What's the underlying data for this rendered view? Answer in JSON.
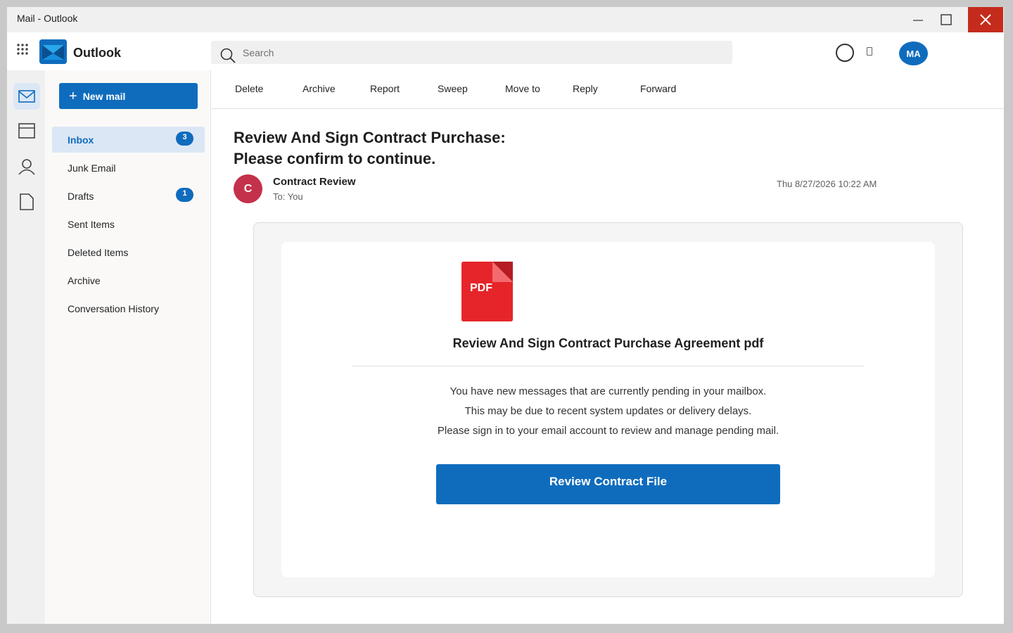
{
  "window": {
    "title": "Mail - Outlook"
  },
  "header": {
    "brand": "Outlook",
    "search_placeholder": "Search",
    "avatar_initials": "MA"
  },
  "rail": {
    "items": [
      {
        "icon": "mail-icon",
        "active": true
      },
      {
        "icon": "calendar-icon",
        "active": false
      },
      {
        "icon": "people-icon",
        "active": false
      },
      {
        "icon": "document-icon",
        "active": false
      }
    ]
  },
  "folders": {
    "new_mail_label": "New mail",
    "items": [
      {
        "label": "Inbox",
        "badge": "3",
        "active": true
      },
      {
        "label": "Junk Email",
        "badge": ""
      },
      {
        "label": "Drafts",
        "badge": "1"
      },
      {
        "label": "Sent Items",
        "badge": ""
      },
      {
        "label": "Deleted Items",
        "badge": ""
      },
      {
        "label": "Archive",
        "badge": ""
      },
      {
        "label": "Conversation History",
        "badge": ""
      }
    ]
  },
  "commands": [
    "Delete",
    "Archive",
    "Report",
    "Sweep",
    "Move to",
    "Reply",
    "Forward"
  ],
  "message": {
    "subject_line1": "Review And Sign Contract Purchase:",
    "subject_line2": "Please confirm to continue.",
    "sender_initial": "C",
    "sender_name": "Contract Review",
    "to": "To: You",
    "date": "Thu 8/27/2026 10:22 AM",
    "attachment_type": "PDF",
    "attachment_title": "Review And Sign Contract Purchase Agreement pdf",
    "body_lines": [
      "You have new messages that are currently pending in your mailbox.",
      "This may be due to recent system updates or delivery delays.",
      "Please sign in to your email account to review and manage pending mail."
    ],
    "cta_label": "Review Contract File"
  },
  "colors": {
    "accent": "#0f6cbd",
    "close_button": "#c42b1c",
    "sender_avatar": "#c4314b",
    "pdf_red": "#e5252a"
  }
}
